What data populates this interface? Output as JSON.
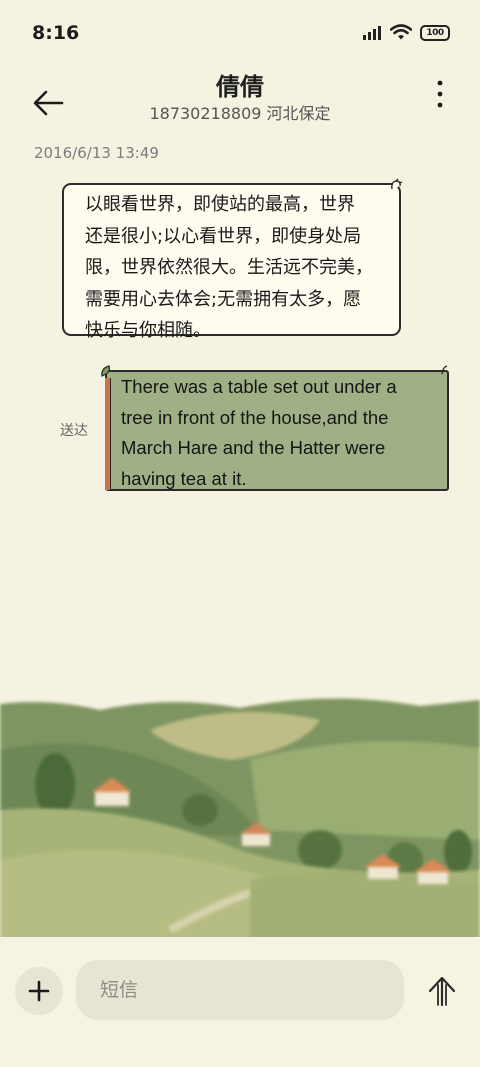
{
  "status_bar": {
    "time": "8:16",
    "battery": "100"
  },
  "header": {
    "contact_name": "倩倩",
    "contact_subtitle": "18730218809 河北保定"
  },
  "conversation": {
    "timestamp": "2016/6/13 13:49",
    "messages": [
      {
        "direction": "incoming",
        "lines": [
          "以眼看世界，即使站的最高，世界",
          "还是很小;以心看世界，即使身处局",
          "限，世界依然很大。生活远不完美，",
          "需要用心去体会;无需拥有太多，愿",
          "快乐与你相随。"
        ]
      },
      {
        "direction": "outgoing",
        "status": "送达",
        "lines": [
          "There was a table set out under a",
          "tree in front of the house,and the",
          "March Hare and the Hatter were",
          "having tea at it."
        ]
      }
    ]
  },
  "composer": {
    "placeholder": "短信"
  },
  "icons": {
    "back": "back-arrow-icon",
    "more": "more-vertical-icon",
    "add": "plus-icon",
    "send": "send-arrow-icon",
    "signal": "signal-icon",
    "wifi": "wifi-icon",
    "battery": "battery-icon"
  },
  "colors": {
    "background": "#f6f2e1",
    "incoming_bubble": "#fffbee",
    "outgoing_bubble": "#9fb086",
    "outgoing_stripe": "#c7734e",
    "input_bg": "#e8e4d3"
  }
}
